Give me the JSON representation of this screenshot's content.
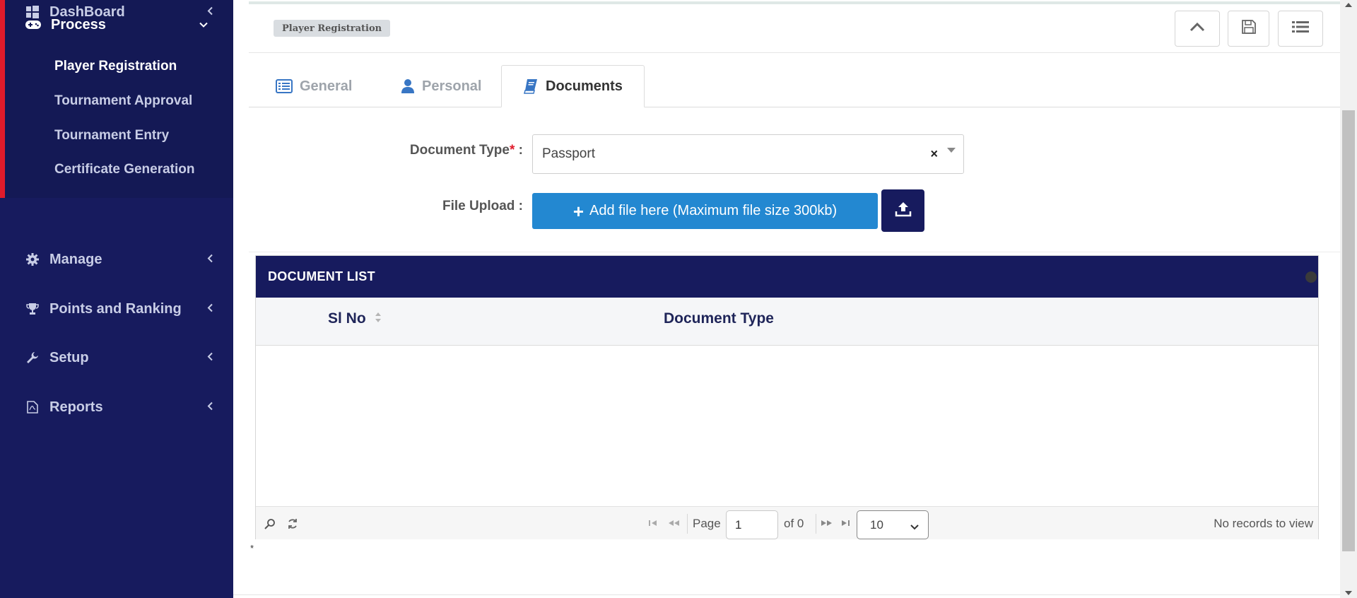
{
  "sidebar": {
    "dashboard": "DashBoard",
    "process": "Process",
    "process_items": [
      "Player Registration",
      "Tournament Approval",
      "Tournament Entry",
      "Certificate Generation"
    ],
    "manage": "Manage",
    "points": "Points and Ranking",
    "setup": "Setup",
    "reports": "Reports"
  },
  "header": {
    "breadcrumb": "Player Registration"
  },
  "tabs": [
    {
      "label": "General"
    },
    {
      "label": "Personal"
    },
    {
      "label": "Documents"
    }
  ],
  "form": {
    "doc_type_label": "Document Type",
    "doc_type_req": "*",
    "doc_type_colon": " :",
    "doc_type_value": "Passport",
    "clear": "×",
    "file_upload_label": "File Upload :",
    "add_file_label": "Add file here (Maximum file size 300kb)"
  },
  "grid": {
    "caption": "DOCUMENT LIST",
    "columns": [
      "Sl No",
      "Document Type"
    ],
    "pager": {
      "page_label": "Page",
      "page_value": "1",
      "of_label": "of 0",
      "page_size": "10",
      "status": "No records to view"
    }
  },
  "footnote": "*",
  "colors": {
    "sidebar_bg": "#171b5e",
    "accent_red": "#e01b2b",
    "primary_blue": "#2388d1"
  }
}
